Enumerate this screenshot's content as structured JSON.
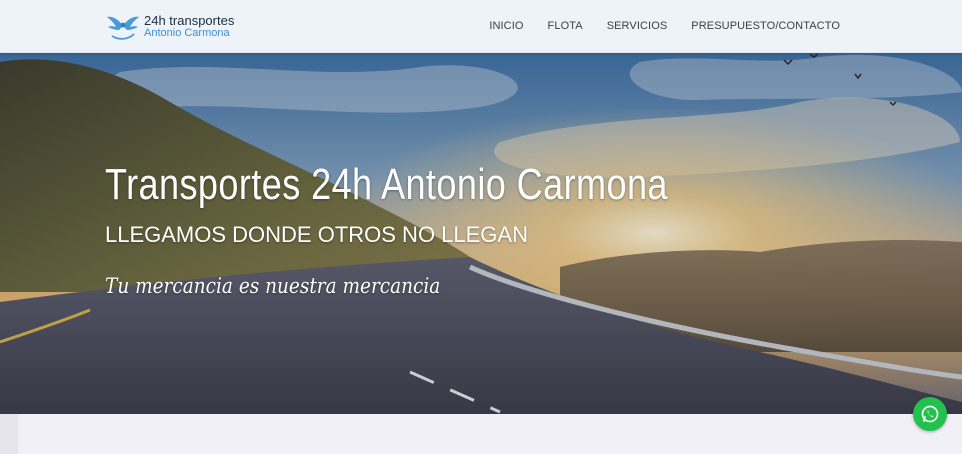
{
  "header": {
    "logo": {
      "line1": "24h transportes",
      "line2": "Antonio Carmona",
      "icon": "winged-logo-icon"
    },
    "nav": [
      {
        "label": "INICIO"
      },
      {
        "label": "FLOTA"
      },
      {
        "label": "SERVICIOS"
      },
      {
        "label": "PRESUPUESTO/CONTACTO"
      }
    ]
  },
  "hero": {
    "title": "Transportes 24h Antonio Carmona",
    "subtitle": "LLEGAMOS DONDE OTROS NO LLEGAN",
    "tagline": "Tu mercancia es nuestra mercancia"
  },
  "floating": {
    "whatsapp_icon": "whatsapp-icon",
    "color": "#22c04d"
  }
}
